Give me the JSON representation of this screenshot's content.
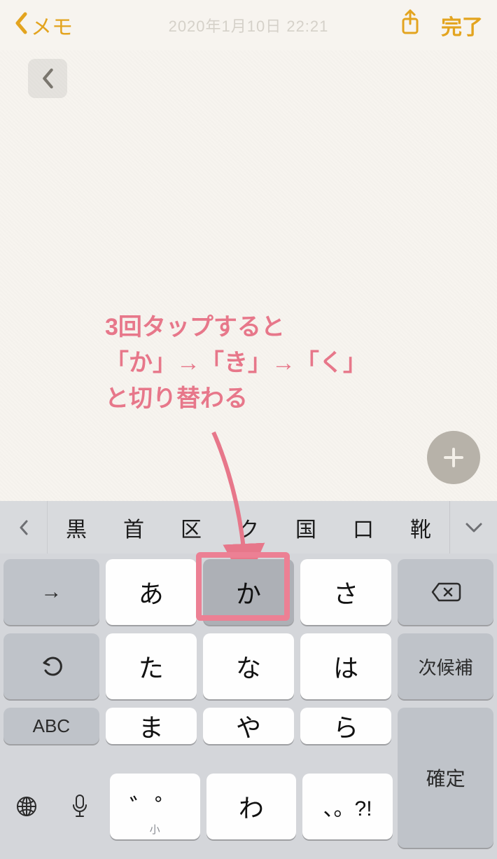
{
  "header": {
    "back_label": "メモ",
    "timestamp": "2020年1月10日 22:21",
    "done_label": "完了"
  },
  "note": {
    "annotation_line1": "3回タップすると",
    "annotation_line2": "「か」→「き」→「く」",
    "annotation_line3": "と切り替わる"
  },
  "candidates": {
    "items": [
      "黒",
      "首",
      "区",
      "ク",
      "国",
      "口",
      "靴"
    ]
  },
  "keyboard": {
    "row1": {
      "func_left": "→",
      "k1": "あ",
      "k2": "か",
      "k3": "さ"
    },
    "row2": {
      "k1": "た",
      "k2": "な",
      "k3": "は",
      "func_right": "次候補"
    },
    "row3": {
      "func_left": "ABC",
      "k1": "ま",
      "k2": "や",
      "k3": "ら"
    },
    "row4": {
      "k1": "゛゜",
      "k1_sub": "小",
      "k2": "わ",
      "k3": "、。?!",
      "func_right": "確定"
    }
  },
  "colors": {
    "accent": "#e3a41f",
    "annotation": "#e7778a",
    "highlight": "#ec8094"
  }
}
